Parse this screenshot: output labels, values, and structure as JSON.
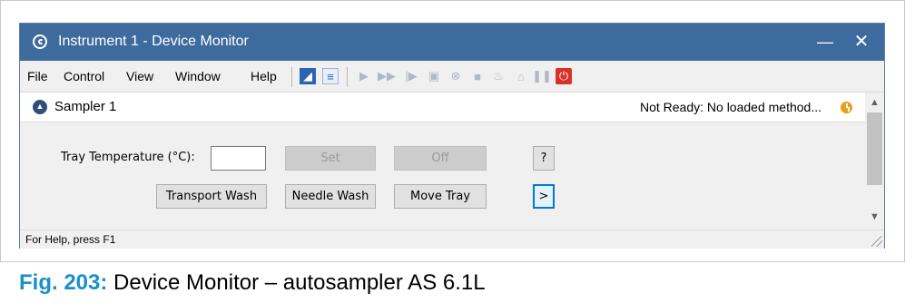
{
  "window": {
    "title": "Instrument 1 - Device Monitor",
    "minimize": "—",
    "close": "✕"
  },
  "menu": {
    "items": [
      "File",
      "Control",
      "View",
      "Window",
      "Help"
    ]
  },
  "toolbar": {
    "icons": [
      "logo-icon",
      "report-icon",
      "play-icon",
      "fast-forward-icon",
      "step-icon",
      "camera-icon",
      "cancel-icon",
      "stop-icon",
      "device-icon",
      "rinse-icon",
      "pause-icon",
      "power-icon"
    ]
  },
  "section": {
    "title": "Sampler 1",
    "status": "Not Ready: No loaded method..."
  },
  "controls": {
    "tray_temp_label": "Tray Temperature (°C):",
    "tray_temp_value": "",
    "set_label": "Set",
    "off_label": "Off",
    "help_label": "?",
    "transport_wash_label": "Transport Wash",
    "needle_wash_label": "Needle Wash",
    "move_tray_label": "Move Tray",
    "more_label": ">"
  },
  "statusbar": {
    "text": "For Help, press F1"
  },
  "caption": {
    "fig": "Fig. 203:",
    "text": " Device Monitor – autosampler AS 6.1L"
  },
  "colors": {
    "titlebar": "#3e6b9e",
    "caption_accent": "#1b8fc9",
    "status_clock": "#e3a21a",
    "power_red": "#d8312a"
  }
}
